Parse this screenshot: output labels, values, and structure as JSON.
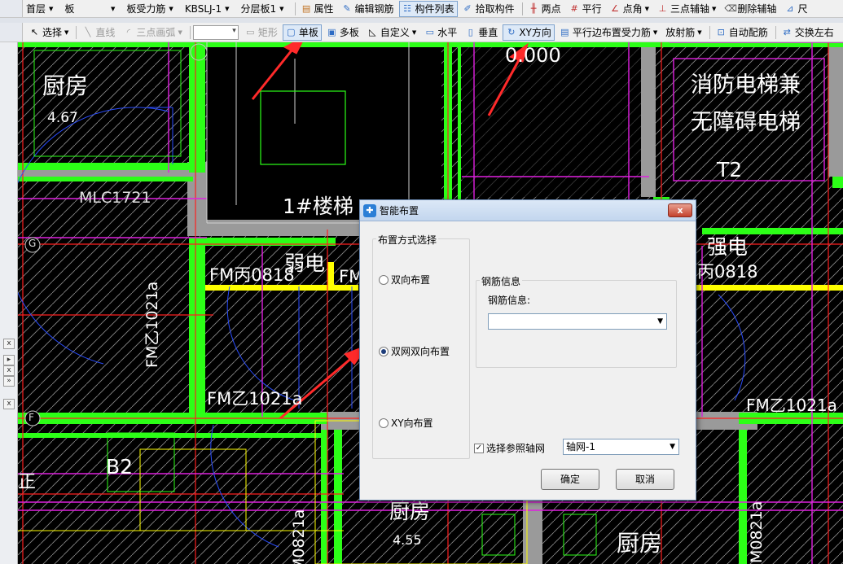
{
  "toolbar1": {
    "floor": "首层",
    "component_type": "板",
    "sub_type": "板受力筋",
    "component_name": "KBSLJ-1",
    "layer": "分层板1",
    "properties": "属性",
    "edit_rebar": "编辑钢筋",
    "component_list": "构件列表",
    "pick_component": "拾取构件",
    "two_points": "两点",
    "parallel": "平行",
    "point_angle": "点角",
    "three_point_aux": "三点辅轴",
    "delete_aux": "删除辅轴",
    "more": "尺"
  },
  "toolbar2": {
    "select": "选择",
    "line": "直线",
    "three_point_arc": "三点画弧",
    "rectangle": "矩形",
    "single_slab": "单板",
    "multi_slab": "多板",
    "custom": "自定义",
    "horizontal": "水平",
    "vertical": "垂直",
    "xy_direction": "XY方向",
    "parallel_edge": "平行边布置受力筋",
    "radial": "放射筋",
    "auto_rebar": "自动配筋",
    "swap_lr": "交换左右"
  },
  "left_strip": {
    "close1": "x",
    "expand": "▸",
    "close2": "x",
    "more": "»",
    "close3": "x"
  },
  "cad": {
    "kitchen_top": "厨房",
    "kitchen_top_area": "4.67",
    "mlc": "MLC1721",
    "stair": "1#楼梯",
    "elev_code": "0.000",
    "elevator_line1": "消防电梯兼",
    "elevator_line2": "无障碍电梯",
    "t2": "T2",
    "axis_g": "G",
    "axis_f": "F",
    "weak_elec": "弱电",
    "strong_elec": "强电",
    "fm_bing_left": "FM丙0818",
    "fm_bing_right": "丙0818",
    "fm_bing_partial": "FM",
    "fm_yi_vertical": "FM乙1021a",
    "fm_yi_left": "FM乙1021a",
    "fm_yi_right": "FM乙1021a",
    "b2": "B2",
    "kitchen_bottom": "厨房",
    "kitchen_bottom_area": "4.55",
    "kitchen_bottom2": "厨房",
    "m0821_left": "M0821a",
    "m0821_right": "M0821a",
    "edge_char": "正"
  },
  "dialog": {
    "title": "智能布置",
    "close": "x",
    "layout_group": "布置方式选择",
    "option_bidirectional": "双向布置",
    "option_double_net": "双网双向布置",
    "option_xy": "XY向布置",
    "selected_option": "option_double_net",
    "rebar_group": "钢筋信息",
    "rebar_label": "钢筋信息:",
    "rebar_value": "",
    "use_grid_label": "选择参照轴网",
    "use_grid_checked": true,
    "grid_value": "轴网-1",
    "ok": "确定",
    "cancel": "取消"
  },
  "colors": {
    "wall": "#2cff17",
    "axis": "#ff1f1f",
    "magenta": "#e020e0",
    "yellow": "#ffff00",
    "arrow": "#ff2a2a"
  }
}
